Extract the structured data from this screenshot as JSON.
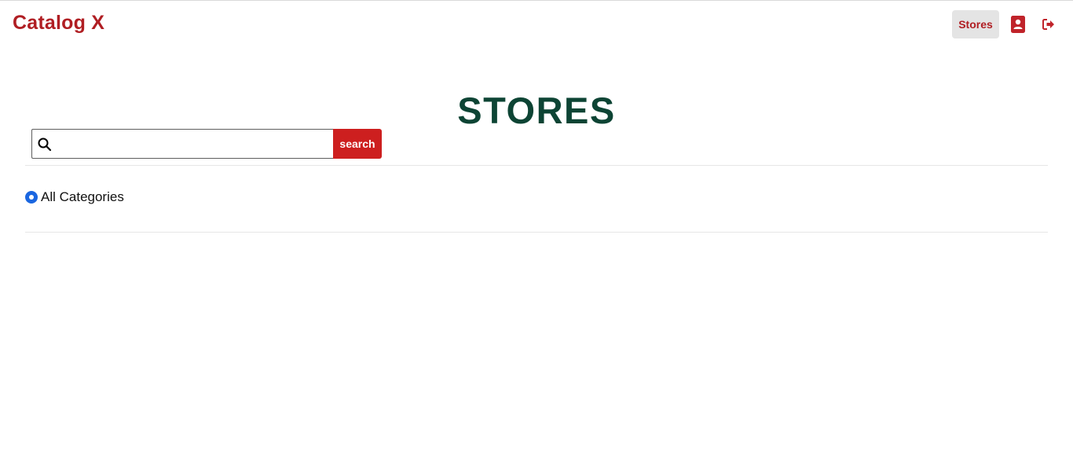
{
  "app": {
    "brand": "Catalog X"
  },
  "nav": {
    "stores_label": "Stores",
    "profile_icon": "contact-card-icon",
    "logout_icon": "sign-out-icon"
  },
  "page": {
    "title": "STORES"
  },
  "search": {
    "value": "",
    "placeholder": "",
    "button_label": "search",
    "icon": "search-icon"
  },
  "filters": {
    "categories": [
      {
        "label": "All Categories",
        "selected": true
      }
    ]
  },
  "colors": {
    "brand": "#b01e23",
    "title": "#0d4434",
    "search_button": "#cd1f1f",
    "radio": "#1a66e0"
  }
}
